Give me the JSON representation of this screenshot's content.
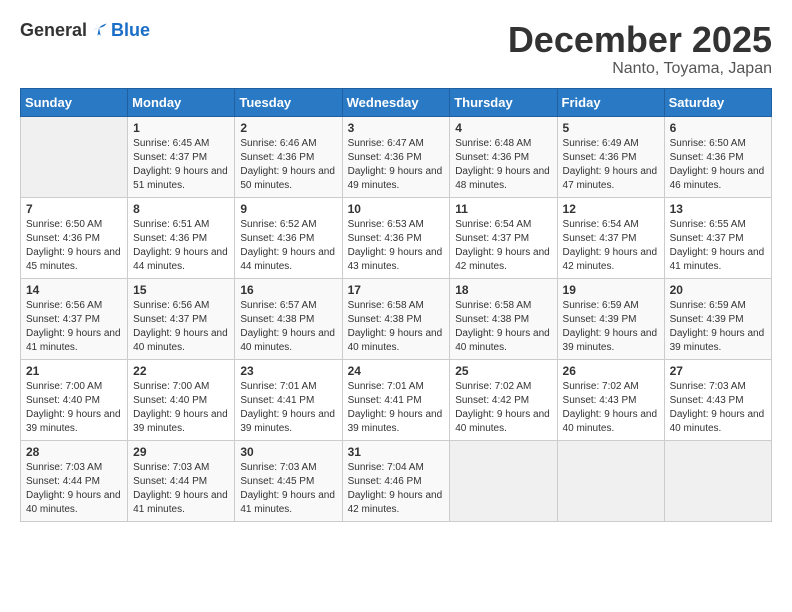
{
  "header": {
    "logo": {
      "general": "General",
      "blue": "Blue"
    },
    "title": "December 2025",
    "location": "Nanto, Toyama, Japan"
  },
  "calendar": {
    "weekdays": [
      "Sunday",
      "Monday",
      "Tuesday",
      "Wednesday",
      "Thursday",
      "Friday",
      "Saturday"
    ],
    "weeks": [
      [
        {
          "day": "",
          "sunrise": "",
          "sunset": "",
          "daylight": ""
        },
        {
          "day": "1",
          "sunrise": "Sunrise: 6:45 AM",
          "sunset": "Sunset: 4:37 PM",
          "daylight": "Daylight: 9 hours and 51 minutes."
        },
        {
          "day": "2",
          "sunrise": "Sunrise: 6:46 AM",
          "sunset": "Sunset: 4:36 PM",
          "daylight": "Daylight: 9 hours and 50 minutes."
        },
        {
          "day": "3",
          "sunrise": "Sunrise: 6:47 AM",
          "sunset": "Sunset: 4:36 PM",
          "daylight": "Daylight: 9 hours and 49 minutes."
        },
        {
          "day": "4",
          "sunrise": "Sunrise: 6:48 AM",
          "sunset": "Sunset: 4:36 PM",
          "daylight": "Daylight: 9 hours and 48 minutes."
        },
        {
          "day": "5",
          "sunrise": "Sunrise: 6:49 AM",
          "sunset": "Sunset: 4:36 PM",
          "daylight": "Daylight: 9 hours and 47 minutes."
        },
        {
          "day": "6",
          "sunrise": "Sunrise: 6:50 AM",
          "sunset": "Sunset: 4:36 PM",
          "daylight": "Daylight: 9 hours and 46 minutes."
        }
      ],
      [
        {
          "day": "7",
          "sunrise": "Sunrise: 6:50 AM",
          "sunset": "Sunset: 4:36 PM",
          "daylight": "Daylight: 9 hours and 45 minutes."
        },
        {
          "day": "8",
          "sunrise": "Sunrise: 6:51 AM",
          "sunset": "Sunset: 4:36 PM",
          "daylight": "Daylight: 9 hours and 44 minutes."
        },
        {
          "day": "9",
          "sunrise": "Sunrise: 6:52 AM",
          "sunset": "Sunset: 4:36 PM",
          "daylight": "Daylight: 9 hours and 44 minutes."
        },
        {
          "day": "10",
          "sunrise": "Sunrise: 6:53 AM",
          "sunset": "Sunset: 4:36 PM",
          "daylight": "Daylight: 9 hours and 43 minutes."
        },
        {
          "day": "11",
          "sunrise": "Sunrise: 6:54 AM",
          "sunset": "Sunset: 4:37 PM",
          "daylight": "Daylight: 9 hours and 42 minutes."
        },
        {
          "day": "12",
          "sunrise": "Sunrise: 6:54 AM",
          "sunset": "Sunset: 4:37 PM",
          "daylight": "Daylight: 9 hours and 42 minutes."
        },
        {
          "day": "13",
          "sunrise": "Sunrise: 6:55 AM",
          "sunset": "Sunset: 4:37 PM",
          "daylight": "Daylight: 9 hours and 41 minutes."
        }
      ],
      [
        {
          "day": "14",
          "sunrise": "Sunrise: 6:56 AM",
          "sunset": "Sunset: 4:37 PM",
          "daylight": "Daylight: 9 hours and 41 minutes."
        },
        {
          "day": "15",
          "sunrise": "Sunrise: 6:56 AM",
          "sunset": "Sunset: 4:37 PM",
          "daylight": "Daylight: 9 hours and 40 minutes."
        },
        {
          "day": "16",
          "sunrise": "Sunrise: 6:57 AM",
          "sunset": "Sunset: 4:38 PM",
          "daylight": "Daylight: 9 hours and 40 minutes."
        },
        {
          "day": "17",
          "sunrise": "Sunrise: 6:58 AM",
          "sunset": "Sunset: 4:38 PM",
          "daylight": "Daylight: 9 hours and 40 minutes."
        },
        {
          "day": "18",
          "sunrise": "Sunrise: 6:58 AM",
          "sunset": "Sunset: 4:38 PM",
          "daylight": "Daylight: 9 hours and 40 minutes."
        },
        {
          "day": "19",
          "sunrise": "Sunrise: 6:59 AM",
          "sunset": "Sunset: 4:39 PM",
          "daylight": "Daylight: 9 hours and 39 minutes."
        },
        {
          "day": "20",
          "sunrise": "Sunrise: 6:59 AM",
          "sunset": "Sunset: 4:39 PM",
          "daylight": "Daylight: 9 hours and 39 minutes."
        }
      ],
      [
        {
          "day": "21",
          "sunrise": "Sunrise: 7:00 AM",
          "sunset": "Sunset: 4:40 PM",
          "daylight": "Daylight: 9 hours and 39 minutes."
        },
        {
          "day": "22",
          "sunrise": "Sunrise: 7:00 AM",
          "sunset": "Sunset: 4:40 PM",
          "daylight": "Daylight: 9 hours and 39 minutes."
        },
        {
          "day": "23",
          "sunrise": "Sunrise: 7:01 AM",
          "sunset": "Sunset: 4:41 PM",
          "daylight": "Daylight: 9 hours and 39 minutes."
        },
        {
          "day": "24",
          "sunrise": "Sunrise: 7:01 AM",
          "sunset": "Sunset: 4:41 PM",
          "daylight": "Daylight: 9 hours and 39 minutes."
        },
        {
          "day": "25",
          "sunrise": "Sunrise: 7:02 AM",
          "sunset": "Sunset: 4:42 PM",
          "daylight": "Daylight: 9 hours and 40 minutes."
        },
        {
          "day": "26",
          "sunrise": "Sunrise: 7:02 AM",
          "sunset": "Sunset: 4:43 PM",
          "daylight": "Daylight: 9 hours and 40 minutes."
        },
        {
          "day": "27",
          "sunrise": "Sunrise: 7:03 AM",
          "sunset": "Sunset: 4:43 PM",
          "daylight": "Daylight: 9 hours and 40 minutes."
        }
      ],
      [
        {
          "day": "28",
          "sunrise": "Sunrise: 7:03 AM",
          "sunset": "Sunset: 4:44 PM",
          "daylight": "Daylight: 9 hours and 40 minutes."
        },
        {
          "day": "29",
          "sunrise": "Sunrise: 7:03 AM",
          "sunset": "Sunset: 4:44 PM",
          "daylight": "Daylight: 9 hours and 41 minutes."
        },
        {
          "day": "30",
          "sunrise": "Sunrise: 7:03 AM",
          "sunset": "Sunset: 4:45 PM",
          "daylight": "Daylight: 9 hours and 41 minutes."
        },
        {
          "day": "31",
          "sunrise": "Sunrise: 7:04 AM",
          "sunset": "Sunset: 4:46 PM",
          "daylight": "Daylight: 9 hours and 42 minutes."
        },
        {
          "day": "",
          "sunrise": "",
          "sunset": "",
          "daylight": ""
        },
        {
          "day": "",
          "sunrise": "",
          "sunset": "",
          "daylight": ""
        },
        {
          "day": "",
          "sunrise": "",
          "sunset": "",
          "daylight": ""
        }
      ]
    ]
  }
}
